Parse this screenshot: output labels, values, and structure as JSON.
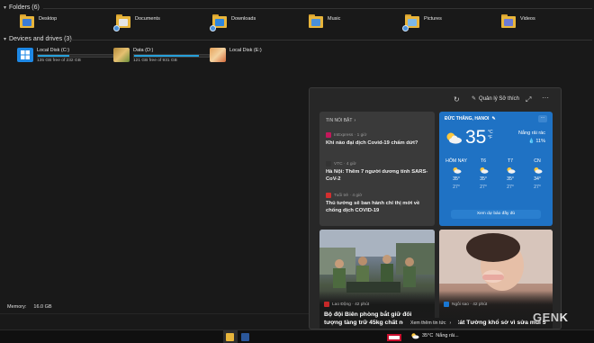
{
  "explorer": {
    "folders_header": "Folders (6)",
    "folders": [
      {
        "name": "Desktop",
        "badge_color": "#3a7bd5"
      },
      {
        "name": "Documents",
        "badge_color": "#e6e6e6"
      },
      {
        "name": "Downloads",
        "badge_color": "#2e86de"
      },
      {
        "name": "Music",
        "badge_color": "#4a90d9"
      },
      {
        "name": "Pictures",
        "badge_color": "#7db8e8"
      },
      {
        "name": "Videos",
        "badge_color": "#6c7bd5"
      }
    ],
    "drives_header": "Devices and drives (3)",
    "drives": [
      {
        "name": "Local Disk (C:)",
        "sub": "135 GB free of 232 GB",
        "used_fraction": 0.42
      },
      {
        "name": "Data (D:)",
        "sub": "121 GB free of 931 GB",
        "used_fraction": 0.87
      },
      {
        "name": "Local Disk (E:)",
        "sub": "",
        "used_fraction": null
      }
    ],
    "memory_label": "Memory:",
    "memory_value": "16.0 GB"
  },
  "news_panel": {
    "header": {
      "refresh_icon": "refresh-icon",
      "manage_label": "Quản lý Sở thích",
      "expand_icon": "expand-icon",
      "more_icon": "more-icon"
    },
    "top_stories": {
      "title": "TIN NỔI BẬT",
      "items": [
        {
          "source": "InExpress · 1 giờ",
          "headline": "Khi nào đại dịch Covid-19 chấm dứt?",
          "logo_color": "#c2185b"
        },
        {
          "source": "VTC · 4 giờ",
          "headline": "Hà Nội: Thêm 7 người dương tính SARS-CoV-2",
          "logo_color": "#333333"
        },
        {
          "source": "Tuổi trẻ · 4 giờ",
          "headline": "Thủ tướng sẽ ban hành chỉ thị mới về chống dịch COVID-19",
          "logo_color": "#d32f2f"
        }
      ]
    },
    "weather": {
      "location": "ĐỨC THẮNG, HANOI",
      "temp": "35",
      "unit_c": "°C",
      "unit_f": "°F",
      "condition": "Nắng rải rác",
      "rain": "11%",
      "days": [
        {
          "label": "HÔM NAY",
          "hi": "35°",
          "lo": "27°",
          "icon": "sun-cloud-icon"
        },
        {
          "label": "T6",
          "hi": "35°",
          "lo": "27°",
          "icon": "sun-cloud-icon"
        },
        {
          "label": "T7",
          "hi": "35°",
          "lo": "27°",
          "icon": "sun-cloud-icon"
        },
        {
          "label": "CN",
          "hi": "34°",
          "lo": "27°",
          "icon": "sun-cloud-icon"
        }
      ],
      "button": "Xem dự báo đầy đủ"
    },
    "photo_stories": [
      {
        "source": "Lao Động · 42 phút",
        "headline": "Bộ đội Biên phòng bắt giữ đối tượng tàng trữ 45kg chất nổ",
        "logo_color": "#c62828"
      },
      {
        "source": "Ngôi sao · 42 phút",
        "headline": "MC Cát Tường khổ sở vì sửa mũi 5",
        "logo_color": "#1976d2"
      }
    ],
    "see_more": "Xem thêm tin tức"
  },
  "taskbar": {
    "weather_temp": "35°C",
    "weather_text": "Nắng rải..."
  },
  "watermark": {
    "text_a": "GEN",
    "text_b": "K"
  }
}
